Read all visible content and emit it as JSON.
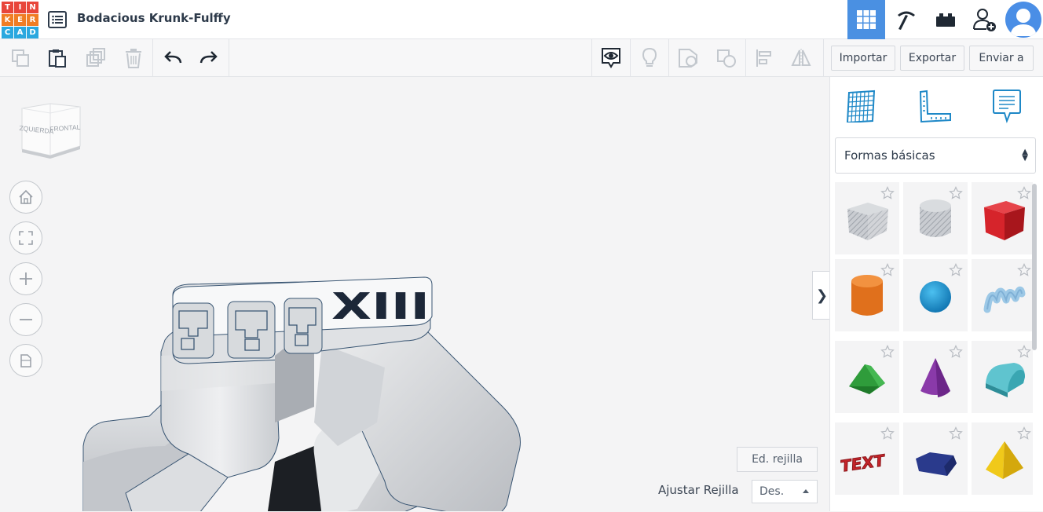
{
  "app": {
    "logo_letters": [
      "T",
      "I",
      "N",
      "K",
      "E",
      "R",
      "C",
      "A",
      "D"
    ],
    "logo_colors": [
      "#e8463b",
      "#e8463b",
      "#e8463b",
      "#f07d24",
      "#f07d24",
      "#f07d24",
      "#2aa8df",
      "#2aa8df",
      "#2aa8df"
    ],
    "design_title": "Bodacious Krunk-Fulffy",
    "accent": "#4a90e2"
  },
  "header": {
    "icons": [
      "grid-3d-icon",
      "pickaxe-icon",
      "bricks-icon",
      "add-user-icon",
      "avatar"
    ]
  },
  "toolbar": {
    "import_label": "Importar",
    "export_label": "Exportar",
    "send_label": "Enviar a"
  },
  "workplane": {
    "viewcube_left": "IZQUIERDA",
    "viewcube_front": "FRONTAL",
    "edit_grid_label": "Ed. rejilla",
    "snap_label": "Ajustar Rejilla",
    "snap_value": "Des.",
    "model_text": "XIII"
  },
  "panel": {
    "category": "Formas básicas",
    "shapes": [
      {
        "name": "Cubo (agujero)",
        "color": "#b9bec6"
      },
      {
        "name": "Cilindro (agujero)",
        "color": "#b9bec6"
      },
      {
        "name": "Cubo",
        "color": "#d6242b"
      },
      {
        "name": "Cilindro",
        "color": "#ea7722"
      },
      {
        "name": "Esfera",
        "color": "#1e9bd7"
      },
      {
        "name": "Garabato",
        "color": "#9cc8e6"
      },
      {
        "name": "Techo",
        "color": "#2f9c3b"
      },
      {
        "name": "Cono",
        "color": "#8a3aa9"
      },
      {
        "name": "Techo redondo",
        "color": "#5fc4cf"
      },
      {
        "name": "Texto",
        "color": "#c4242a"
      },
      {
        "name": "Polígono",
        "color": "#2a3a8c"
      },
      {
        "name": "Pirámide",
        "color": "#f0c91a"
      }
    ],
    "text_shape_label": "TEXT"
  }
}
